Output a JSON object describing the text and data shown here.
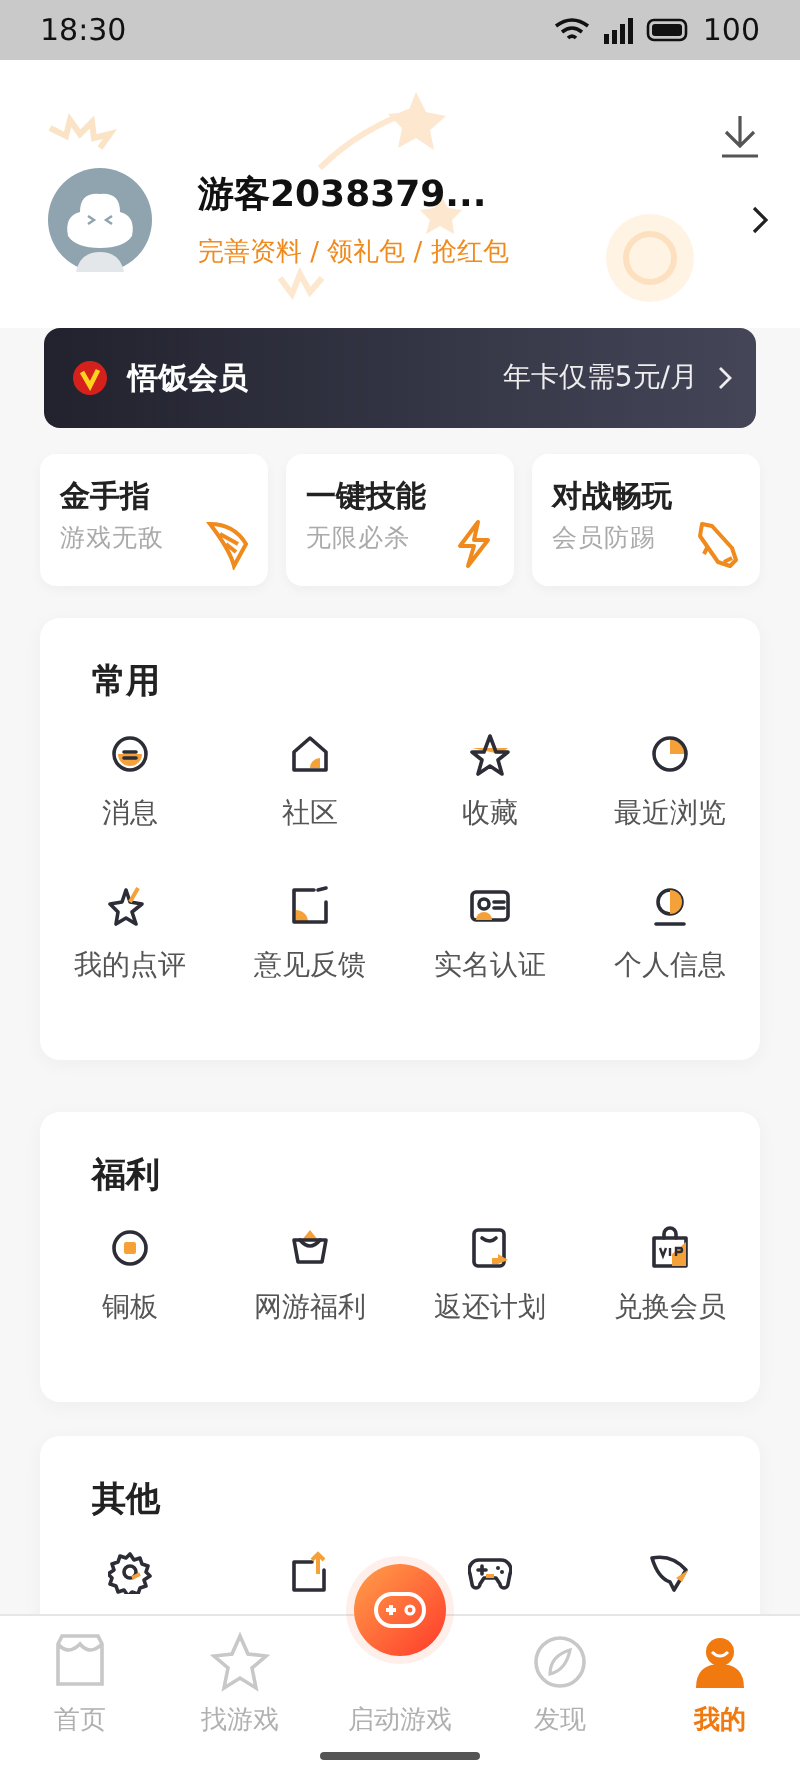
{
  "status_bar": {
    "time": "18:30",
    "battery": "100"
  },
  "profile": {
    "name": "游客2038379...",
    "links": "完善资料 / 领礼包 / 抢红包"
  },
  "member_bar": {
    "title": "悟饭会员",
    "offer": "年卡仅需5元/月"
  },
  "features": [
    {
      "title": "金手指",
      "subtitle": "游戏无敌"
    },
    {
      "title": "一键技能",
      "subtitle": "无限必杀"
    },
    {
      "title": "对战畅玩",
      "subtitle": "会员防踢"
    }
  ],
  "sections": [
    {
      "title": "常用",
      "items": [
        "消息",
        "社区",
        "收藏",
        "最近浏览",
        "我的点评",
        "意见反馈",
        "实名认证",
        "个人信息"
      ]
    },
    {
      "title": "福利",
      "items": [
        "铜板",
        "网游福利",
        "返还计划",
        "兑换会员"
      ]
    },
    {
      "title": "其他"
    }
  ],
  "tabs": [
    {
      "label": "首页",
      "selected": false
    },
    {
      "label": "找游戏",
      "selected": false
    },
    {
      "label": "启动游戏",
      "selected": false,
      "kind": "center"
    },
    {
      "label": "发现",
      "selected": false
    },
    {
      "label": "我的",
      "selected": true
    }
  ]
}
